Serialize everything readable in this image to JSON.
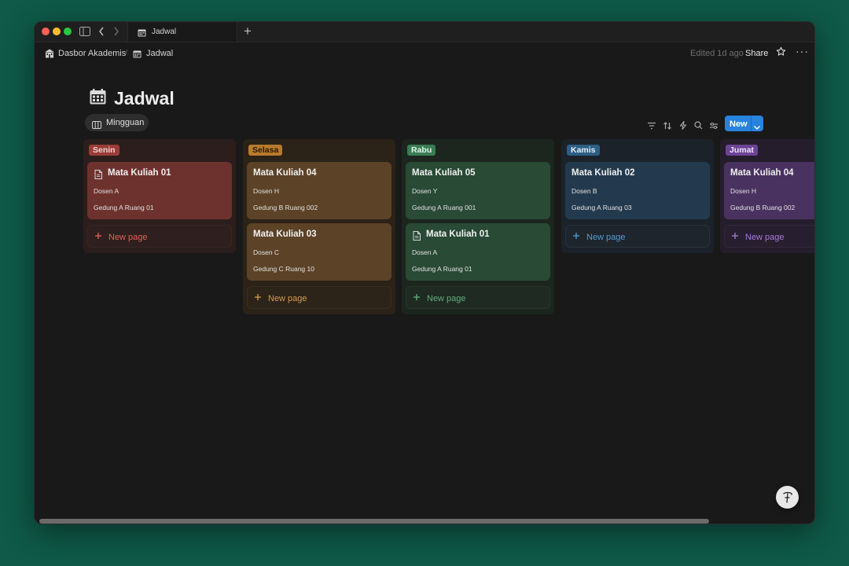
{
  "window": {
    "tab_title": "Jadwal",
    "new_tab_symbol": "+"
  },
  "breadcrumb": {
    "workspace": "Dasbor Akademis",
    "separator": "/",
    "page": "Jadwal"
  },
  "header": {
    "edited": "Edited 1d ago",
    "share": "Share",
    "more": "···"
  },
  "page": {
    "title": "Jadwal",
    "view_name": "Mingguan"
  },
  "toolbar": {
    "icons": [
      "filter-icon",
      "sort-icon",
      "automation-icon",
      "search-icon",
      "settings-icon"
    ],
    "new_label": "New"
  },
  "colors": {
    "senin": "#9a3c37",
    "selasa": "#b87a2b",
    "rabu": "#3a7c53",
    "kamis": "#2c5f84",
    "jumat": "#6c4396",
    "new_button": "#2783de"
  },
  "columns": [
    {
      "name": "Senin",
      "new_page": "New page",
      "cards": [
        {
          "title": "Mata Kuliah 01",
          "lecturer": "Dosen A",
          "room": "Gedung A Ruang 01"
        }
      ]
    },
    {
      "name": "Selasa",
      "new_page": "New page",
      "cards": [
        {
          "title": "Mata Kuliah 04",
          "lecturer": "Dosen H",
          "room": "Gedung B Ruang 002"
        },
        {
          "title": "Mata Kuliah 03",
          "lecturer": "Dosen C",
          "room": "Gedung C Ruang 10"
        }
      ]
    },
    {
      "name": "Rabu",
      "new_page": "New page",
      "cards": [
        {
          "title": "Mata Kuliah 05",
          "lecturer": "Dosen Y",
          "room": "Gedung A Ruang 001"
        },
        {
          "title": "Mata Kuliah 01",
          "lecturer": "Dosen A",
          "room": "Gedung A Ruang 01"
        }
      ]
    },
    {
      "name": "Kamis",
      "new_page": "New page",
      "cards": [
        {
          "title": "Mata Kuliah 02",
          "lecturer": "Dosen B",
          "room": "Gedung A Ruang 03"
        }
      ]
    },
    {
      "name": "Jumat",
      "new_page": "New page",
      "cards": [
        {
          "title": "Mata Kuliah 04",
          "lecturer": "Dosen H",
          "room": "Gedung B Ruang 002"
        }
      ]
    }
  ]
}
